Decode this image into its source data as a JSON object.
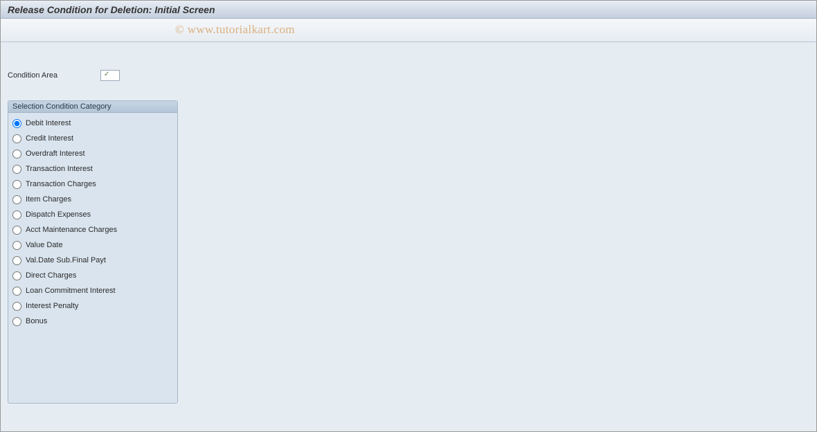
{
  "header": {
    "title": "Release Condition for Deletion: Initial Screen"
  },
  "watermark": "© www.tutorialkart.com",
  "fields": {
    "condition_area_label": "Condition Area",
    "condition_area_value": ""
  },
  "group": {
    "title": "Selection Condition Category",
    "options": [
      {
        "label": "Debit Interest",
        "selected": true
      },
      {
        "label": "Credit Interest",
        "selected": false
      },
      {
        "label": "Overdraft Interest",
        "selected": false
      },
      {
        "label": "Transaction Interest",
        "selected": false
      },
      {
        "label": "Transaction Charges",
        "selected": false
      },
      {
        "label": "Item Charges",
        "selected": false
      },
      {
        "label": "Dispatch Expenses",
        "selected": false
      },
      {
        "label": "Acct Maintenance Charges",
        "selected": false
      },
      {
        "label": "Value Date",
        "selected": false
      },
      {
        "label": "Val.Date Sub.Final Payt",
        "selected": false
      },
      {
        "label": "Direct Charges",
        "selected": false
      },
      {
        "label": "Loan Commitment Interest",
        "selected": false
      },
      {
        "label": "Interest Penalty",
        "selected": false
      },
      {
        "label": "Bonus",
        "selected": false
      }
    ]
  }
}
